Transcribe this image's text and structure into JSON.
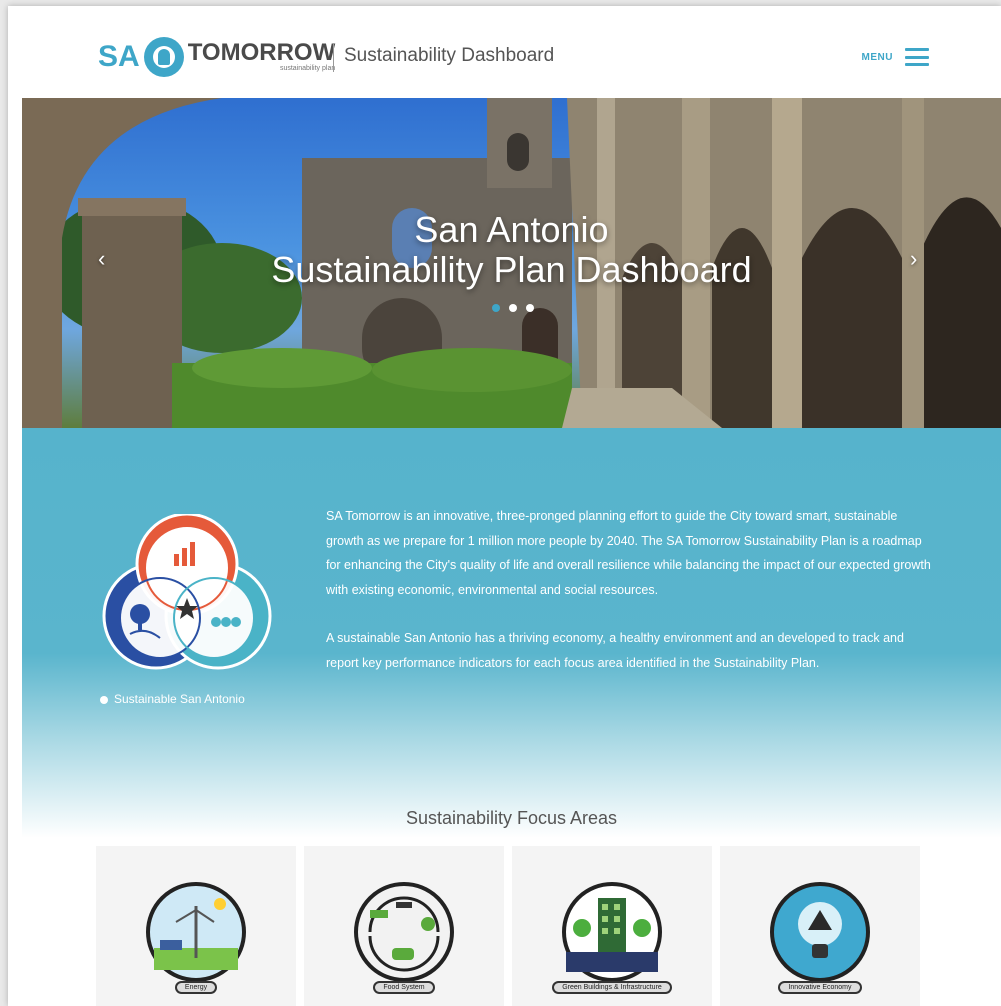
{
  "header": {
    "logo_sa": "SA",
    "logo_tomorrow": "TOMORROW",
    "logo_sub": "sustainability plan",
    "title": "Sustainability Dashboard",
    "menu_label": "MENU"
  },
  "hero": {
    "title_line1": "San Antonio",
    "title_line2": "Sustainability Plan Dashboard",
    "prev_arrow": "‹",
    "next_arrow": "›",
    "slides": 3,
    "active_slide": 1
  },
  "intro": {
    "paragraph1": "SA Tomorrow is an innovative, three-pronged planning effort to guide the City toward smart, sustainable growth as we prepare for 1 million more people by 2040. The SA Tomorrow Sustainability Plan is a roadmap for enhancing the City's quality of life and overall resilience while balancing the impact of our expected growth with existing economic, environmental and social resources.",
    "paragraph2": "A sustainable San Antonio has a thriving economy, a healthy environment and an developed to track and report key performance indicators for each focus area identified in the Sustainability Plan.",
    "badge_caption": "Sustainable San Antonio"
  },
  "focus": {
    "title": "Sustainability Focus Areas",
    "cards": [
      {
        "label": "Energy"
      },
      {
        "label": "Food System"
      },
      {
        "label": "Green Buildings & Infrastructure"
      },
      {
        "label": "Innovative Economy"
      }
    ]
  },
  "colors": {
    "accent": "#3ea6c8",
    "intro_bg": "#56b3cc",
    "economy": "#e55a3a",
    "environment": "#2a4fa3",
    "social": "#4ab3c7"
  }
}
